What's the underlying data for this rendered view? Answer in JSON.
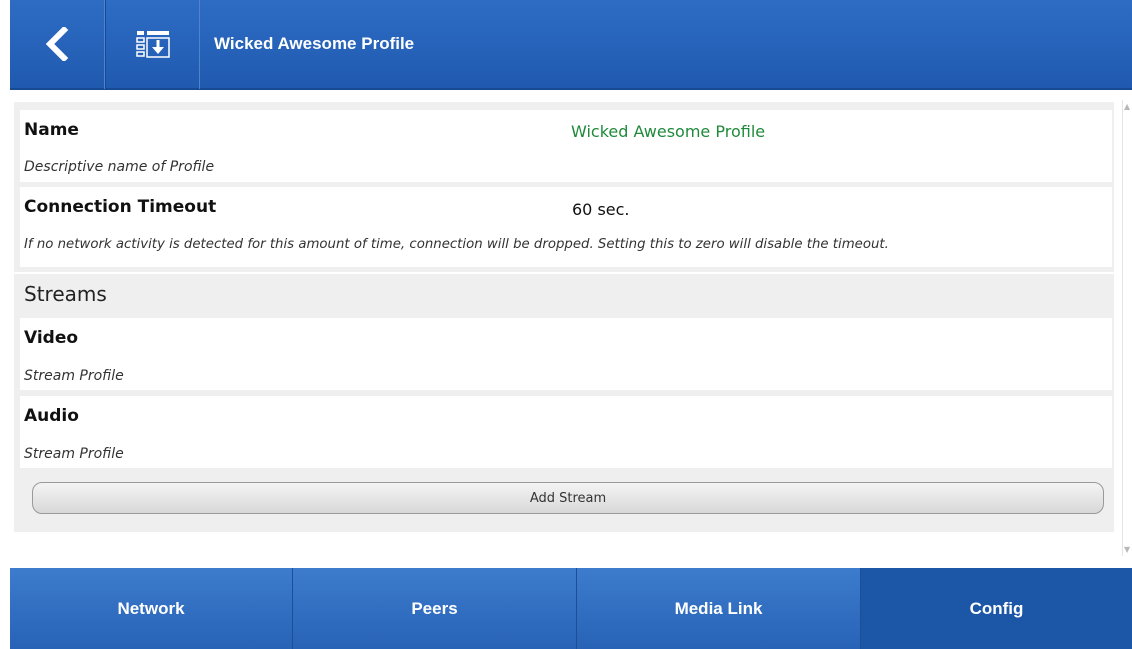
{
  "header": {
    "back_icon": "chevron-left-icon",
    "save_icon": "list-download-icon",
    "title": "Wicked Awesome Profile"
  },
  "profile": {
    "name": {
      "label": "Name",
      "description": "Descriptive name of Profile",
      "value": "Wicked Awesome Profile",
      "value_color": "#1f8a3a"
    },
    "timeout": {
      "label": "Connection Timeout",
      "value": "60 sec.",
      "description": "If no network activity is detected for this amount of time, connection will be dropped. Setting this to zero will disable the timeout."
    }
  },
  "streams": {
    "title": "Streams",
    "items": [
      {
        "label": "Video",
        "description": "Stream Profile"
      },
      {
        "label": "Audio",
        "description": "Stream Profile"
      }
    ],
    "add_label": "Add Stream"
  },
  "footer": {
    "tabs": [
      {
        "label": "Network"
      },
      {
        "label": "Peers"
      },
      {
        "label": "Media Link"
      },
      {
        "label": "Config",
        "active": true
      }
    ]
  },
  "colors": {
    "header_blue": "#2662b8",
    "tab_blue": "#3270c2",
    "tab_active": "#1c56a6"
  }
}
